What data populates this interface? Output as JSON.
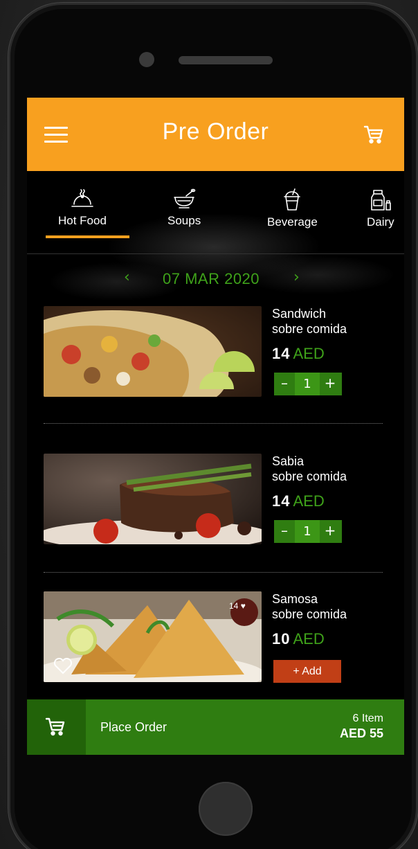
{
  "header": {
    "title": "Pre Order",
    "menu_icon": "hamburger-menu-icon",
    "cart_icon": "cart-icon"
  },
  "tabs": [
    {
      "label": "Hot Food",
      "icon": "cloche-icon",
      "active": true
    },
    {
      "label": "Soups",
      "icon": "soup-bowl-icon",
      "active": false
    },
    {
      "label": "Beverage",
      "icon": "drink-cup-icon",
      "active": false
    },
    {
      "label": "Dairy",
      "icon": "milk-carton-icon",
      "active": false
    }
  ],
  "date": {
    "label": "07 MAR 2020",
    "prev": "‹",
    "next": "›"
  },
  "items": [
    {
      "name": "Sandwich",
      "subtitle": "sobre comida",
      "price": "14",
      "currency": "AED",
      "qty": "1",
      "minus": "–",
      "plus": "+"
    },
    {
      "name": "Sabia",
      "subtitle": "sobre comida",
      "price": "14",
      "currency": "AED",
      "qty": "1",
      "minus": "–",
      "plus": "+"
    },
    {
      "name": "Samosa",
      "subtitle": "sobre comida",
      "price": "10",
      "currency": "AED",
      "add_label": "+ Add",
      "likes": "14"
    }
  ],
  "order": {
    "label": "Place Order",
    "count": "6 Item",
    "total": "AED 55"
  },
  "colors": {
    "accent": "#f8a01f",
    "green": "#2f7d11",
    "green_text": "#3fa21a",
    "add": "#c13f16"
  }
}
